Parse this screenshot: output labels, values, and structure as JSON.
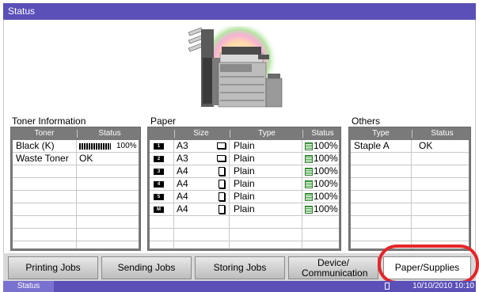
{
  "window": {
    "title": "Status"
  },
  "toner": {
    "section_title": "Toner Information",
    "headers": [
      "Toner",
      "Status"
    ],
    "rows": [
      {
        "name": "Black (K)",
        "status": "100%",
        "level_percent": 100
      },
      {
        "name": "Waste Toner",
        "status": "OK"
      }
    ]
  },
  "paper": {
    "section_title": "Paper",
    "headers": [
      "Size",
      "Type",
      "Status"
    ],
    "rows": [
      {
        "tray": "1",
        "size": "A3",
        "orientation": "landscape",
        "type": "Plain",
        "status": "100%"
      },
      {
        "tray": "2",
        "size": "A3",
        "orientation": "landscape",
        "type": "Plain",
        "status": "100%"
      },
      {
        "tray": "3",
        "size": "A4",
        "orientation": "portrait",
        "type": "Plain",
        "status": "100%"
      },
      {
        "tray": "4",
        "size": "A4",
        "orientation": "portrait",
        "type": "Plain",
        "status": "100%"
      },
      {
        "tray": "5",
        "size": "A4",
        "orientation": "portrait",
        "type": "Plain",
        "status": "100%"
      },
      {
        "tray": "M",
        "size": "A4",
        "orientation": "portrait",
        "type": "Plain",
        "status": "100%"
      }
    ]
  },
  "others": {
    "section_title": "Others",
    "headers": [
      "Type",
      "Status"
    ],
    "rows": [
      {
        "type": "Staple A",
        "status": "OK"
      }
    ]
  },
  "tabs": [
    {
      "label": "Printing Jobs"
    },
    {
      "label": "Sending Jobs"
    },
    {
      "label": "Storing Jobs"
    },
    {
      "label": "Device/ Communication"
    },
    {
      "label": "Paper/Supplies",
      "active": true
    }
  ],
  "statusbar": {
    "label": "Status",
    "datetime": "10/10/2010  10:10"
  },
  "colors": {
    "title_bar": "#5a50b8",
    "highlight_circle": "#e4262a",
    "level_icon": "#3fa23f"
  },
  "icons": [
    "printer-machine-image",
    "tray-number-icon",
    "paper-orientation-icon",
    "paper-level-icon",
    "toner-level-bar",
    "paper-tray-icon"
  ]
}
